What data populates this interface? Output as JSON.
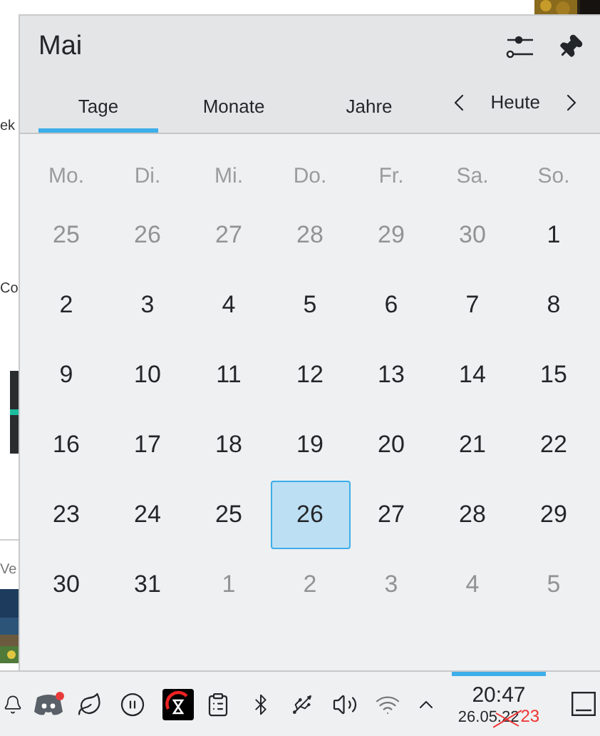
{
  "background": {
    "fragments": [
      "ek",
      "Co",
      "Ve"
    ]
  },
  "popup": {
    "title": "Mai",
    "tabs": [
      {
        "label": "Tage",
        "selected": true
      },
      {
        "label": "Monate",
        "selected": false
      },
      {
        "label": "Jahre",
        "selected": false
      }
    ],
    "today_button": "Heute",
    "weekdays": [
      "Mo.",
      "Di.",
      "Mi.",
      "Do.",
      "Fr.",
      "Sa.",
      "So."
    ],
    "weeks": [
      [
        {
          "day": "25",
          "current_month": false,
          "selected": false
        },
        {
          "day": "26",
          "current_month": false,
          "selected": false
        },
        {
          "day": "27",
          "current_month": false,
          "selected": false
        },
        {
          "day": "28",
          "current_month": false,
          "selected": false
        },
        {
          "day": "29",
          "current_month": false,
          "selected": false
        },
        {
          "day": "30",
          "current_month": false,
          "selected": false
        },
        {
          "day": "1",
          "current_month": true,
          "selected": false
        }
      ],
      [
        {
          "day": "2",
          "current_month": true,
          "selected": false
        },
        {
          "day": "3",
          "current_month": true,
          "selected": false
        },
        {
          "day": "4",
          "current_month": true,
          "selected": false
        },
        {
          "day": "5",
          "current_month": true,
          "selected": false
        },
        {
          "day": "6",
          "current_month": true,
          "selected": false
        },
        {
          "day": "7",
          "current_month": true,
          "selected": false
        },
        {
          "day": "8",
          "current_month": true,
          "selected": false
        }
      ],
      [
        {
          "day": "9",
          "current_month": true,
          "selected": false
        },
        {
          "day": "10",
          "current_month": true,
          "selected": false
        },
        {
          "day": "11",
          "current_month": true,
          "selected": false
        },
        {
          "day": "12",
          "current_month": true,
          "selected": false
        },
        {
          "day": "13",
          "current_month": true,
          "selected": false
        },
        {
          "day": "14",
          "current_month": true,
          "selected": false
        },
        {
          "day": "15",
          "current_month": true,
          "selected": false
        }
      ],
      [
        {
          "day": "16",
          "current_month": true,
          "selected": false
        },
        {
          "day": "17",
          "current_month": true,
          "selected": false
        },
        {
          "day": "18",
          "current_month": true,
          "selected": false
        },
        {
          "day": "19",
          "current_month": true,
          "selected": false
        },
        {
          "day": "20",
          "current_month": true,
          "selected": false
        },
        {
          "day": "21",
          "current_month": true,
          "selected": false
        },
        {
          "day": "22",
          "current_month": true,
          "selected": false
        }
      ],
      [
        {
          "day": "23",
          "current_month": true,
          "selected": false
        },
        {
          "day": "24",
          "current_month": true,
          "selected": false
        },
        {
          "day": "25",
          "current_month": true,
          "selected": false
        },
        {
          "day": "26",
          "current_month": true,
          "selected": true
        },
        {
          "day": "27",
          "current_month": true,
          "selected": false
        },
        {
          "day": "28",
          "current_month": true,
          "selected": false
        },
        {
          "day": "29",
          "current_month": true,
          "selected": false
        }
      ],
      [
        {
          "day": "30",
          "current_month": true,
          "selected": false
        },
        {
          "day": "31",
          "current_month": true,
          "selected": false
        },
        {
          "day": "1",
          "current_month": false,
          "selected": false
        },
        {
          "day": "2",
          "current_month": false,
          "selected": false
        },
        {
          "day": "3",
          "current_month": false,
          "selected": false
        },
        {
          "day": "4",
          "current_month": false,
          "selected": false
        },
        {
          "day": "5",
          "current_month": false,
          "selected": false
        }
      ]
    ]
  },
  "taskbar": {
    "clock": {
      "time": "20:47",
      "date": "26.05.22",
      "annotation": "23",
      "active": true
    },
    "notification_badge": true
  }
}
